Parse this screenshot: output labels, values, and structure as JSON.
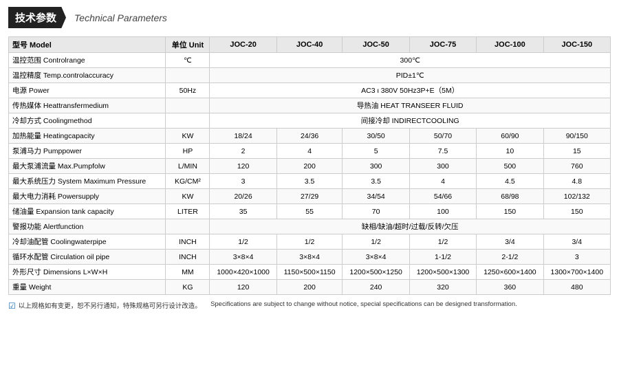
{
  "header": {
    "badge": "技术参数",
    "subtitle": "Technical Parameters"
  },
  "table": {
    "columns": [
      {
        "key": "label",
        "header": "型号 Model"
      },
      {
        "key": "unit",
        "header": "单位 Unit"
      },
      {
        "key": "joc20",
        "header": "JOC-20"
      },
      {
        "key": "joc40",
        "header": "JOC-40"
      },
      {
        "key": "joc50",
        "header": "JOC-50"
      },
      {
        "key": "joc75",
        "header": "JOC-75"
      },
      {
        "key": "joc100",
        "header": "JOC-100"
      },
      {
        "key": "joc150",
        "header": "JOC-150"
      }
    ],
    "rows": [
      {
        "label": "温控范围 Controlrange",
        "unit": "℃",
        "span": "300℃"
      },
      {
        "label": "温控精度 Temp.controlaccuracy",
        "unit": "",
        "span": "PID±1℃"
      },
      {
        "label": "电源 Power",
        "unit": "50Hz",
        "span": "AC3 ι 380V 50Hz3P+E（5M）"
      },
      {
        "label": "传热媒体 Heattransfermedium",
        "unit": "",
        "span": "导热油 HEAT TRANSEER FLUID"
      },
      {
        "label": "冷却方式 Coolingmethod",
        "unit": "",
        "span": "间接冷却 INDIRECTCOOLING"
      },
      {
        "label": "加热能量 Heatingcapacity",
        "unit": "KW",
        "joc20": "18/24",
        "joc40": "24/36",
        "joc50": "30/50",
        "joc75": "50/70",
        "joc100": "60/90",
        "joc150": "90/150"
      },
      {
        "label": "泵浦马力 Pumppower",
        "unit": "HP",
        "joc20": "2",
        "joc40": "4",
        "joc50": "5",
        "joc75": "7.5",
        "joc100": "10",
        "joc150": "15"
      },
      {
        "label": "最大泵浦流量 Max.Pumpfolw",
        "unit": "L/MIN",
        "joc20": "120",
        "joc40": "200",
        "joc50": "300",
        "joc75": "300",
        "joc100": "500",
        "joc150": "760"
      },
      {
        "label": "最大系统压力 System Maximum Pressure",
        "unit": "KG/CM²",
        "joc20": "3",
        "joc40": "3.5",
        "joc50": "3.5",
        "joc75": "4",
        "joc100": "4.5",
        "joc150": "4.8"
      },
      {
        "label": "最大电力消耗 Powersupply",
        "unit": "KW",
        "joc20": "20/26",
        "joc40": "27/29",
        "joc50": "34/54",
        "joc75": "54/66",
        "joc100": "68/98",
        "joc150": "102/132"
      },
      {
        "label": "储油量 Expansion tank capacity",
        "unit": "LITER",
        "joc20": "35",
        "joc40": "55",
        "joc50": "70",
        "joc75": "100",
        "joc100": "150",
        "joc150": "150"
      },
      {
        "label": "警报功能 Alertfunction",
        "unit": "",
        "span": "缺相/缺油/超时/过载/反转/欠压"
      },
      {
        "label": "冷却油配管 Coolingwaterpipe",
        "unit": "INCH",
        "joc20": "1/2",
        "joc40": "1/2",
        "joc50": "1/2",
        "joc75": "1/2",
        "joc100": "3/4",
        "joc150": "3/4"
      },
      {
        "label": "循环水配管 Circulation oil pipe",
        "unit": "INCH",
        "joc20": "3×8×4",
        "joc40": "3×8×4",
        "joc50": "3×8×4",
        "joc75": "1-1/2",
        "joc100": "2-1/2",
        "joc150": "3"
      },
      {
        "label": "外形尺寸 Dimensions L×W×H",
        "unit": "MM",
        "joc20": "1000×420×1000",
        "joc40": "1150×500×1150",
        "joc50": "1200×500×1250",
        "joc75": "1200×500×1300",
        "joc100": "1250×600×1400",
        "joc150": "1300×700×1400"
      },
      {
        "label": "重量 Weight",
        "unit": "KG",
        "joc20": "120",
        "joc40": "200",
        "joc50": "240",
        "joc75": "320",
        "joc100": "360",
        "joc150": "480"
      }
    ]
  },
  "footer": {
    "icon": "☑",
    "text_cn": "以上规格如有变更，恕不另行通知，特殊规格可另行设计改造。",
    "text_en": "Specifications are subject to change without notice, special specifications can be designed transformation."
  }
}
